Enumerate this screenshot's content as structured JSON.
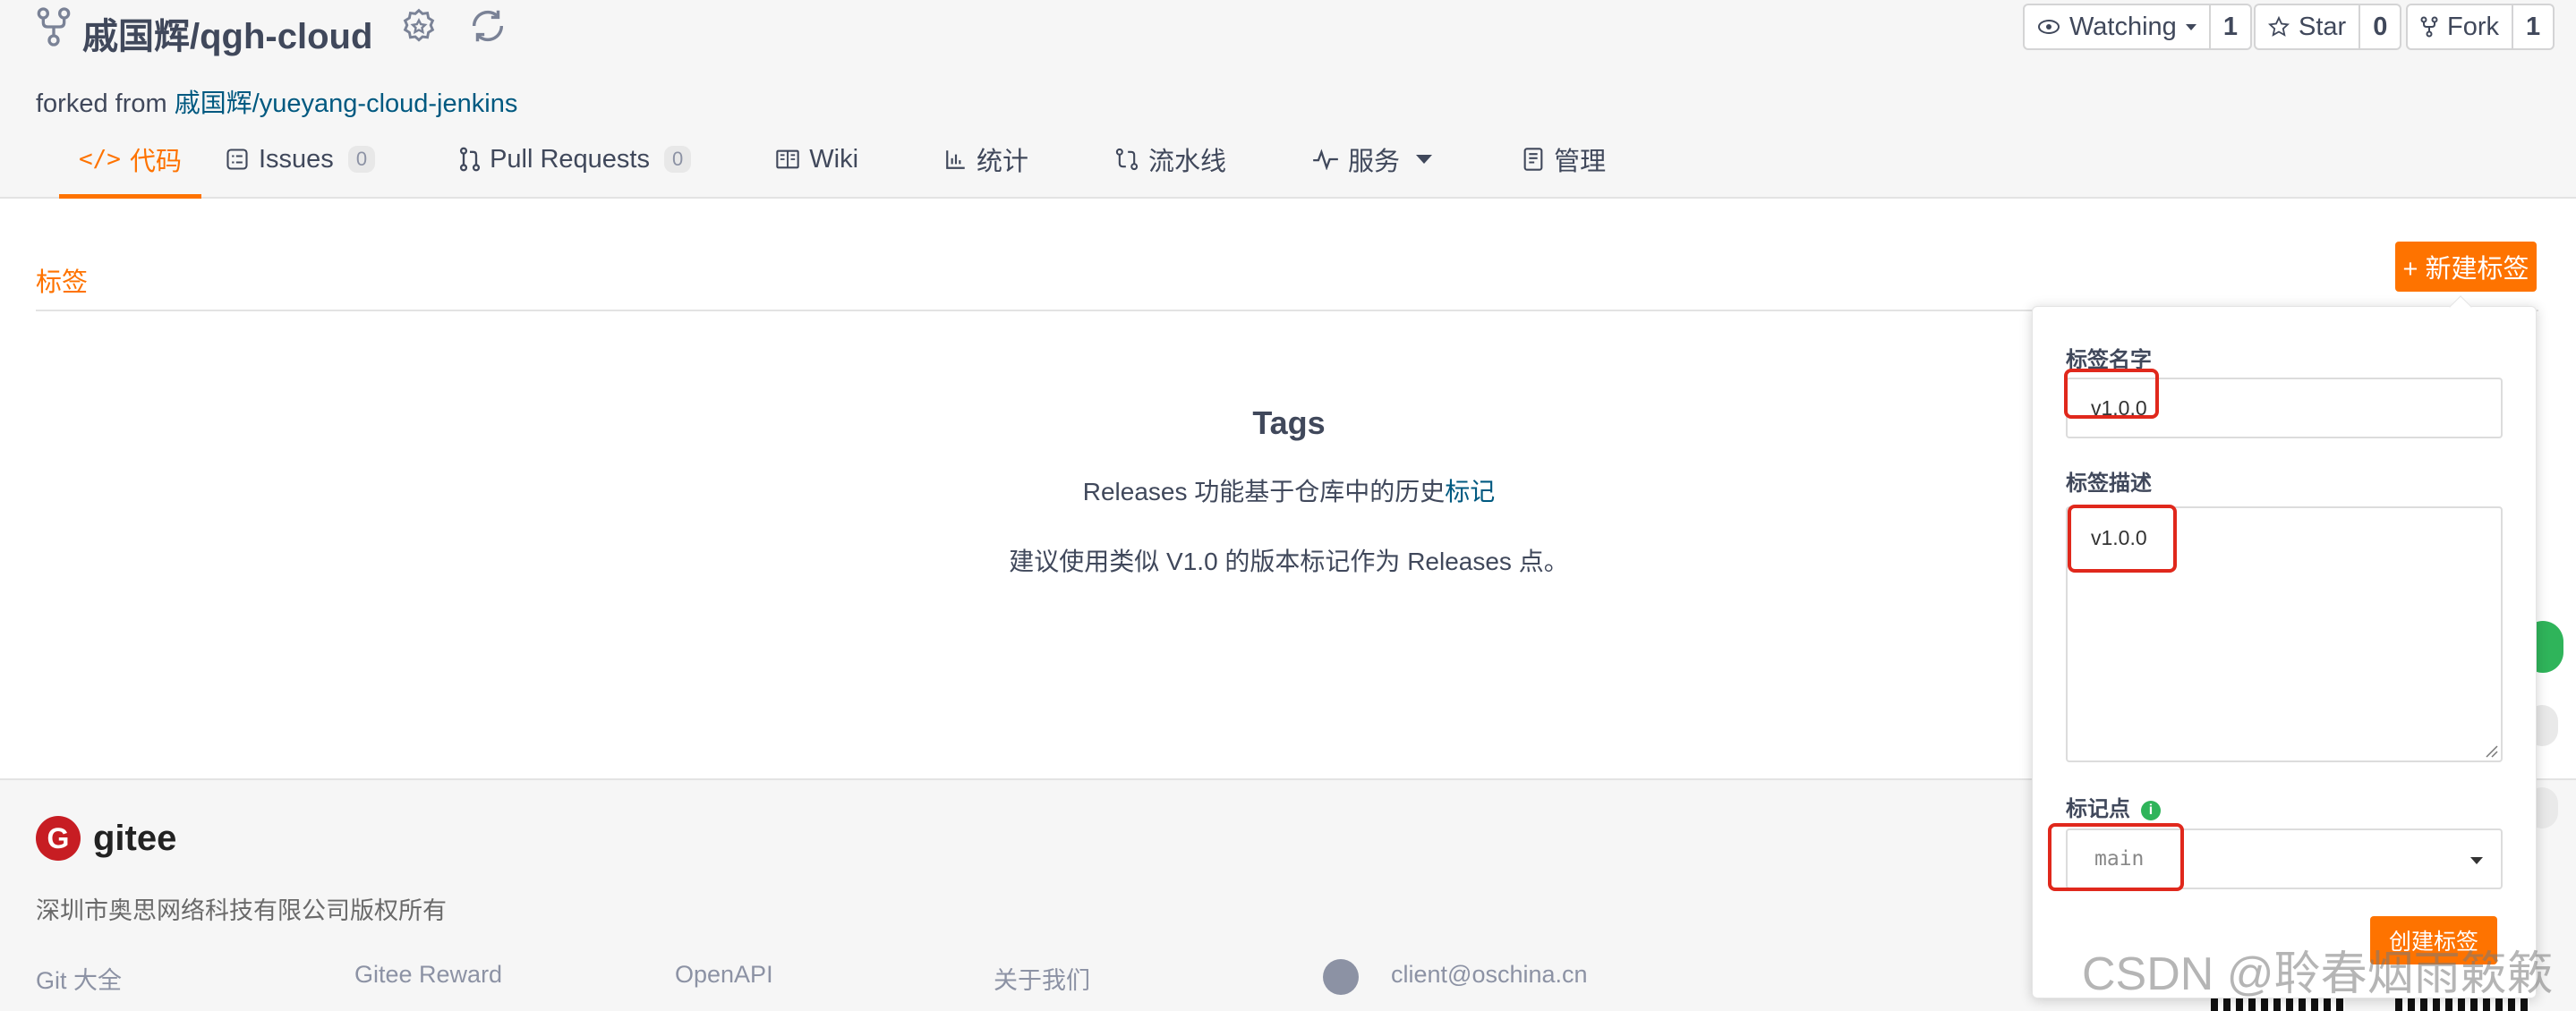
{
  "repo": {
    "owner": "戚国辉",
    "name": "qgh-cloud",
    "title": "戚国辉/qgh-cloud",
    "forked_prefix": "forked from ",
    "forked_link": "戚国辉/yueyang-cloud-jenkins"
  },
  "actions": {
    "watching_label": "Watching",
    "watching_count": "1",
    "star_label": "Star",
    "star_count": "0",
    "fork_label": "Fork",
    "fork_count": "1"
  },
  "nav": {
    "code": "代码",
    "issues": "Issues",
    "issues_count": "0",
    "pull_requests": "Pull Requests",
    "pull_requests_count": "0",
    "wiki": "Wiki",
    "stats": "统计",
    "pipeline": "流水线",
    "services": "服务",
    "manage": "管理"
  },
  "main": {
    "section_title": "标签",
    "new_tag_button": "+ 新建标签",
    "tags_title": "Tags",
    "line1_prefix": "Releases 功能基于仓库中的历史",
    "line1_link": "标记",
    "line2": "建议使用类似 V1.0 的版本标记作为 Releases 点。"
  },
  "form": {
    "name_label": "标签名字",
    "name_value": "v1.0.0",
    "desc_label": "标签描述",
    "desc_value": "v1.0.0",
    "point_label": "标记点",
    "point_value": "main",
    "submit": "创建标签"
  },
  "footer": {
    "logo_letter": "G",
    "logo_text": "gitee",
    "copyright": "深圳市奥思网络科技有限公司版权所有",
    "links": [
      "Git 大全",
      "Gitee Reward",
      "OpenAPI",
      "关于我们"
    ],
    "email": "client@oschina.cn"
  },
  "watermark": "CSDN @聆春烟雨簌簌",
  "colors": {
    "accent": "#fe7300",
    "link": "#005980",
    "highlight_box": "#e0281c",
    "success": "#2fb45a"
  }
}
